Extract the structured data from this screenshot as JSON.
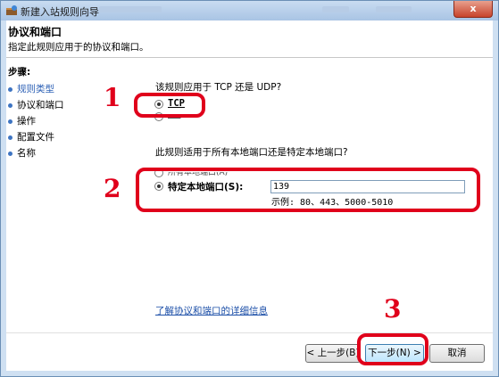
{
  "window": {
    "title": "新建入站规则向导",
    "close_label": "x"
  },
  "header": {
    "title": "协议和端口",
    "subtitle": "指定此规则应用于的协议和端口。"
  },
  "steps": {
    "title": "步骤:",
    "items": [
      {
        "label": "规则类型",
        "state": "done"
      },
      {
        "label": "协议和端口",
        "state": "current"
      },
      {
        "label": "操作",
        "state": "pending"
      },
      {
        "label": "配置文件",
        "state": "pending"
      },
      {
        "label": "名称",
        "state": "pending"
      }
    ]
  },
  "protocol": {
    "question": "该规则应用于 TCP 还是 UDP?",
    "options": [
      {
        "label": "TCP",
        "selected": true
      },
      {
        "label": "UDP",
        "selected": false
      }
    ]
  },
  "ports": {
    "question": "此规则适用于所有本地端口还是特定本地端口?",
    "options": [
      {
        "label": "所有本地端口(A)",
        "selected": false
      },
      {
        "label": "特定本地端口(S):",
        "selected": true
      }
    ],
    "value": "139",
    "example": "示例: 80、443、5000-5010"
  },
  "link": "了解协议和端口的详细信息",
  "buttons": {
    "back": "< 上一步(B)",
    "next": "下一步(N) >",
    "cancel": "取消"
  },
  "annotations": {
    "n1": "1",
    "n2": "2",
    "n3": "3",
    "color": "#e0001b"
  }
}
